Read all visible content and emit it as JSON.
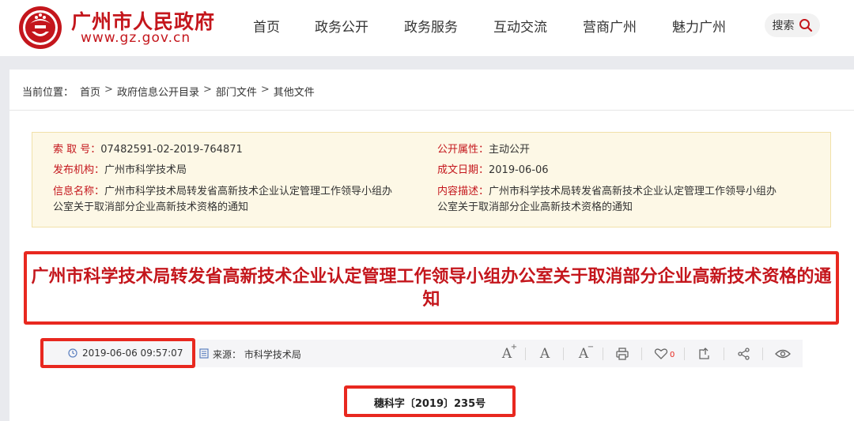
{
  "header": {
    "brand_name": "广州市人民政府",
    "brand_url": "www.gz.gov.cn",
    "nav": [
      "首页",
      "政务公开",
      "政务服务",
      "互动交流",
      "营商广州",
      "魅力广州"
    ],
    "search_label": "搜索"
  },
  "breadcrumb": {
    "prefix": "当前位置：",
    "items": [
      "首页",
      "政府信息公开目录",
      "部门文件",
      "其他文件"
    ],
    "separator": ">"
  },
  "info": {
    "index_no": {
      "key": "索 取 号：",
      "value": "07482591-02-2019-764871"
    },
    "publisher": {
      "key": "发布机构：",
      "value": "广州市科学技术局"
    },
    "info_name": {
      "key": "信息名称：",
      "value": "广州市科学技术局转发省高新技术企业认定管理工作领导小组办公室关于取消部分企业高新技术资格的通知"
    },
    "public_attr": {
      "key": "公开属性：",
      "value": "主动公开"
    },
    "date": {
      "key": "成文日期：",
      "value": "2019-06-06"
    },
    "description": {
      "key": "内容描述：",
      "value": "广州市科学技术局转发省高新技术企业认定管理工作领导小组办公室关于取消部分企业高新技术资格的通知"
    }
  },
  "article": {
    "title": "广州市科学技术局转发省高新技术企业认定管理工作领导小组办公室关于取消部分企业高新技术资格的通知",
    "publish_time": "2019-06-06 09:57:07",
    "source": "来源：  市科学技术局",
    "like_count": "0",
    "doc_number": "穗科字〔2019〕235号"
  },
  "colors": {
    "brand_red": "#c4161c",
    "highlight_red": "#e8281f",
    "info_bg": "#fdf8e6"
  },
  "icons": [
    "logo-emblem",
    "search-icon",
    "clock-icon",
    "document-icon",
    "font-increase-icon",
    "font-normal-icon",
    "font-decrease-icon",
    "print-icon",
    "heart-icon",
    "share-external-icon",
    "share-icon",
    "eye-icon"
  ]
}
